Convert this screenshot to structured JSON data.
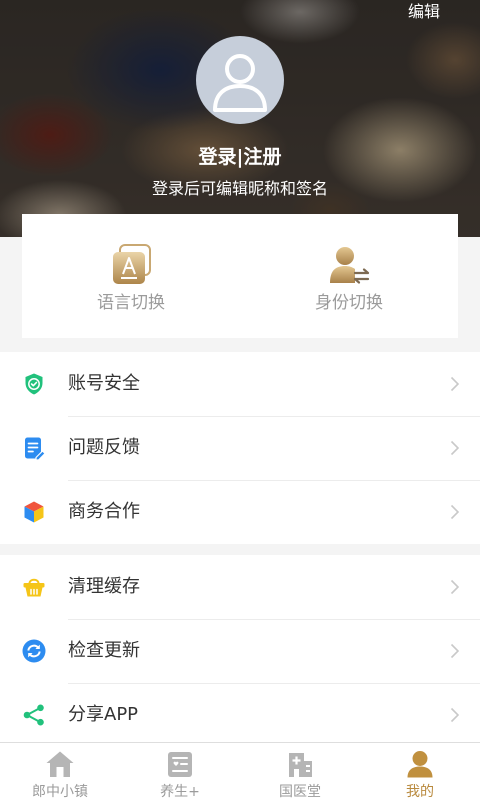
{
  "header": {
    "edit_label": "编辑",
    "login_label": "登录|注册",
    "login_hint": "登录后可编辑昵称和签名"
  },
  "quick_actions": [
    {
      "label": "语言切换",
      "icon": "language-icon"
    },
    {
      "label": "身份切换",
      "icon": "identity-switch-icon"
    }
  ],
  "menu_groups": [
    {
      "items": [
        {
          "label": "账号安全",
          "icon": "shield-icon"
        },
        {
          "label": "问题反馈",
          "icon": "feedback-document-icon"
        },
        {
          "label": "商务合作",
          "icon": "cube-icon"
        }
      ]
    },
    {
      "items": [
        {
          "label": "清理缓存",
          "icon": "basket-icon"
        },
        {
          "label": "检查更新",
          "icon": "refresh-icon"
        },
        {
          "label": "分享APP",
          "icon": "share-icon"
        }
      ]
    }
  ],
  "tabbar": {
    "items": [
      {
        "label": "郎中小镇",
        "icon": "house-icon",
        "active": false
      },
      {
        "label": "养生+",
        "icon": "wellness-card-icon",
        "active": false
      },
      {
        "label": "国医堂",
        "icon": "hospital-icon",
        "active": false
      },
      {
        "label": "我的",
        "icon": "person-icon",
        "active": true
      }
    ]
  },
  "colors": {
    "accent": "#b98a3e",
    "inactive": "#9b9b9b",
    "page_background": "#f4f4f4",
    "text": "#333333",
    "green": "#21c17c",
    "blue": "#2d8cf0",
    "yellow": "#f5c518"
  }
}
